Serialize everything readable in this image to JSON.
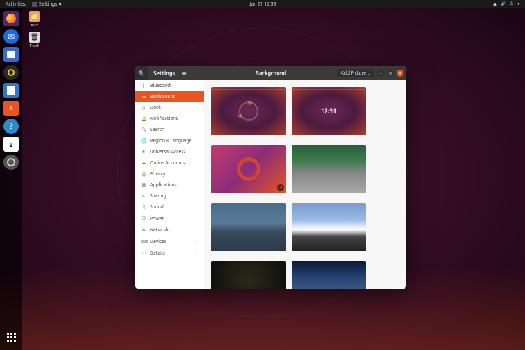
{
  "topbar": {
    "activities": "Activities",
    "app": "Settings",
    "app_chevron": "▾",
    "datetime": "Jan 27  12:39"
  },
  "desktop_icons": [
    {
      "label": "nick",
      "glyph": "📁",
      "bg": "#e9a06f"
    },
    {
      "label": "Trash",
      "glyph": "🗑",
      "bg": "#ccc"
    }
  ],
  "window": {
    "title": "Settings",
    "header_center": "Background",
    "add_button": "Add Picture…",
    "lock_time": "12:39"
  },
  "sidebar": [
    {
      "icon": "ᛒ",
      "label": "Bluetooth"
    },
    {
      "icon": "▭",
      "label": "Background",
      "active": true
    },
    {
      "icon": "▯",
      "label": "Dock"
    },
    {
      "icon": "🔔",
      "label": "Notifications"
    },
    {
      "icon": "🔍",
      "label": "Search"
    },
    {
      "icon": "🌐",
      "label": "Region & Language"
    },
    {
      "icon": "✴",
      "label": "Universal Access"
    },
    {
      "icon": "☁",
      "label": "Online Accounts"
    },
    {
      "icon": "🔒",
      "label": "Privacy"
    },
    {
      "icon": "▦",
      "label": "Applications"
    },
    {
      "icon": "∝",
      "label": "Sharing"
    },
    {
      "icon": "♫",
      "label": "Sound"
    },
    {
      "icon": "⏻",
      "label": "Power"
    },
    {
      "icon": "✲",
      "label": "Network"
    },
    {
      "icon": "⌨",
      "label": "Devices",
      "chevron": "〉"
    },
    {
      "icon": "ⓘ",
      "label": "Details",
      "chevron": "〉"
    }
  ]
}
